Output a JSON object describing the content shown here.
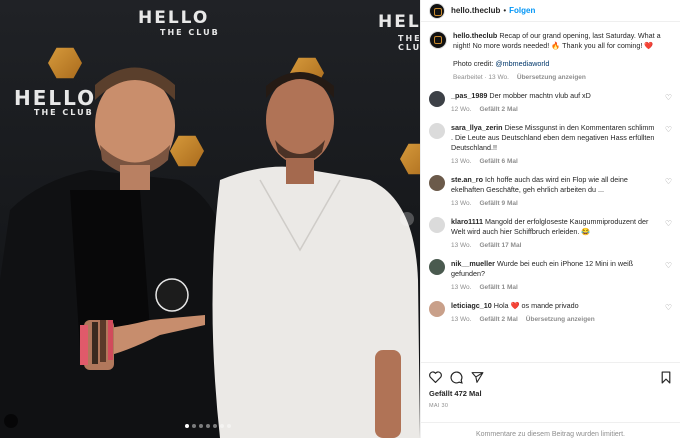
{
  "photo": {
    "backdrop": [
      "HELLO",
      "THE CLUB",
      "HELLO",
      "THE CLUB",
      "HELLO",
      "THE CLUB"
    ]
  },
  "header": {
    "username": "hello.theclub",
    "separator": "•",
    "follow_label": "Folgen"
  },
  "caption": {
    "username": "hello.theclub",
    "text": "Recap of our grand opening, last Saturday. What a night! No more words needed! 🔥 Thank you all for coming! ❤️",
    "credit_prefix": "Photo credit: ",
    "credit_handle": "@mbmediaworld",
    "edited": "Bearbeitet · 13 Wo.",
    "translate": "Übersetzung anzeigen"
  },
  "comments": [
    {
      "username": "_pas_1989",
      "text": "Der mobber machtn vlub auf xD",
      "age": "12 Wo.",
      "likes": "Gefällt 2 Mal",
      "translate": "",
      "avatar_color": "#3d4147"
    },
    {
      "username": "sara_llya_zerin",
      "text": "Diese Missgunst in den Kommentaren schlimm . Die Leute aus Deutschland eben dem negativen Hass erfüllten Deutschland.!!",
      "age": "13 Wo.",
      "likes": "Gefällt 6 Mal",
      "translate": "",
      "avatar_color": "#dbdbdb"
    },
    {
      "username": "ste.an_ro",
      "text": "Ich hoffe auch das wird ein Flop wie all deine ekelhaften Geschäfte, geh ehrlich arbeiten du ...",
      "age": "13 Wo.",
      "likes": "Gefällt 9 Mal",
      "translate": "",
      "avatar_color": "#6b5a4a"
    },
    {
      "username": "klaro1111",
      "text": "Mangold der erfolgloseste Kaugummiproduzent der Welt wird auch hier Schiffbruch erleiden. 😂",
      "age": "13 Wo.",
      "likes": "Gefällt 17 Mal",
      "translate": "",
      "avatar_color": "#dbdbdb"
    },
    {
      "username": "nik__mueller",
      "text": "Wurde bei euch ein iPhone 12 Mini in weiß gefunden?",
      "age": "13 Wo.",
      "likes": "Gefällt 1 Mal",
      "translate": "",
      "avatar_color": "#4a5a4f"
    },
    {
      "username": "leticiagc_10",
      "text": "Hola ❤️ os mande privado",
      "age": "13 Wo.",
      "likes": "Gefällt 2 Mal",
      "translate": "Übersetzung anzeigen",
      "avatar_color": "#c9a08a"
    }
  ],
  "actions": {
    "like_icon": "heart-icon",
    "comment_icon": "comment-icon",
    "share_icon": "share-icon",
    "save_icon": "bookmark-icon",
    "likes_text": "Gefällt 472 Mal",
    "date": "MAI 30"
  },
  "footer": {
    "disabled_text": "Kommentare zu diesem Beitrag wurden limitiert."
  }
}
